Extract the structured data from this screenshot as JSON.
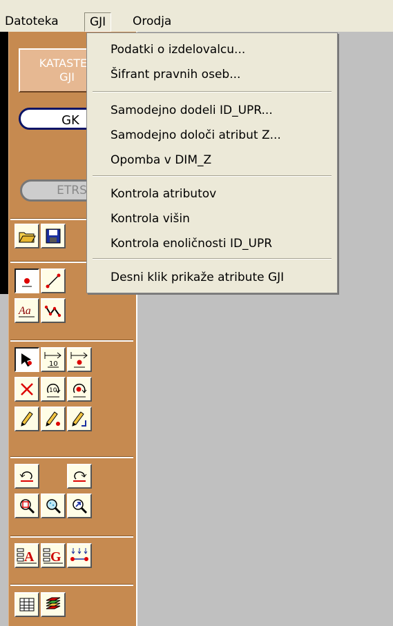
{
  "menubar": {
    "items": [
      {
        "label": "Datoteka"
      },
      {
        "label": "GJI"
      },
      {
        "label": "Orodja"
      }
    ]
  },
  "toolbar": {
    "kataster_line1": "KATASTER",
    "kataster_line2": "GJI",
    "gk_label": "GK",
    "etrs_label": "ETRS"
  },
  "gji_menu": {
    "groups": [
      [
        "Podatki o izdelovalcu...",
        "Šifrant pravnih oseb..."
      ],
      [
        "Samodejno dodeli ID_UPR...",
        "Samodejno določi atribut Z...",
        "Opomba v DIM_Z"
      ],
      [
        "Kontrola atributov",
        "Kontrola višin",
        "Kontrola enoličnosti ID_UPR"
      ],
      [
        "Desni klik prikaže atribute GJI"
      ]
    ]
  },
  "tool_icons": [
    "open-folder-icon",
    "save-disk-icon",
    "point-icon",
    "line-icon",
    "text-icon",
    "polyline-icon",
    "select-arrow-icon",
    "measure-distance-icon",
    "move-point-icon",
    "delete-x-icon",
    "rotate-text-icon",
    "rotate-point-icon",
    "pencil-icon",
    "pencil-point-icon",
    "pencil-corner-icon",
    "undo-icon",
    "redo-icon",
    "zoom-rectangle-icon",
    "zoom-extent-icon",
    "zoom-previous-icon",
    "attribute-a-icon",
    "attribute-g-icon",
    "connect-points-icon",
    "table-icon",
    "layers-icon"
  ]
}
